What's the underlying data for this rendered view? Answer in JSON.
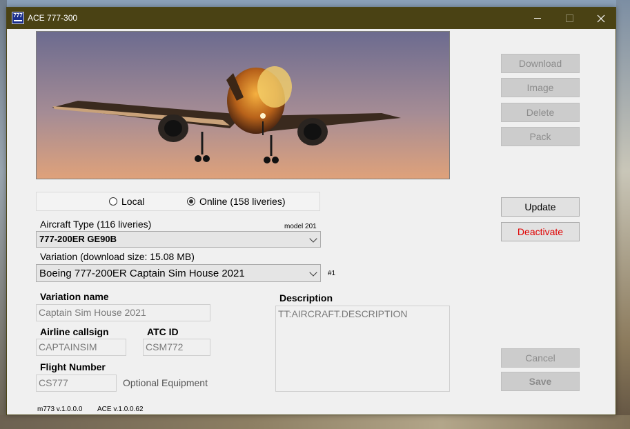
{
  "window": {
    "title": "ACE 777-300",
    "icon_text": "777"
  },
  "actions": {
    "download": "Download",
    "image": "Image",
    "delete": "Delete",
    "pack": "Pack",
    "update": "Update",
    "deactivate": "Deactivate",
    "cancel": "Cancel",
    "save": "Save"
  },
  "source": {
    "local_label": "Local",
    "online_label": "Online  (158 liveries)",
    "selected": "Online"
  },
  "aircraft_type": {
    "label": "Aircraft Type  (116 liveries)",
    "model": "model  201",
    "value": "777-200ER GE90B"
  },
  "variation": {
    "label": "Variation (download size: 15.08 MB)",
    "value": "Boeing 777-200ER Captain Sim House 2021",
    "index": "#1"
  },
  "fields": {
    "variation_name_label": "Variation name",
    "variation_name": "Captain Sim House 2021",
    "airline_callsign_label": "Airline callsign",
    "airline_callsign": "CAPTAINSIM",
    "atc_id_label": "ATC ID",
    "atc_id": "CSM772",
    "flight_number_label": "Flight Number",
    "flight_number": "CS777",
    "optional_equipment": "Optional Equipment",
    "description_label": "Description",
    "description": "TT:AIRCRAFT.DESCRIPTION"
  },
  "footer": {
    "m773_version": "m773 v.1.0.0.0",
    "ace_version": "ACE v.1.0.0.62"
  },
  "colors": {
    "titlebar": "#4a4214",
    "deactivate_text": "#e00000"
  }
}
